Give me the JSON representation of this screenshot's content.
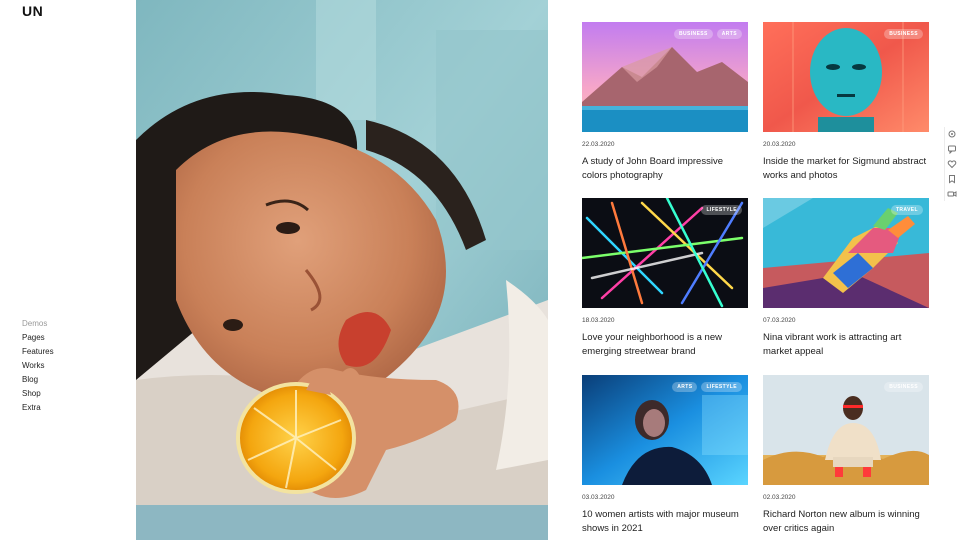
{
  "brand": {
    "logo_text": "UN"
  },
  "nav": {
    "items": [
      {
        "label": "Demos",
        "active": true
      },
      {
        "label": "Pages"
      },
      {
        "label": "Features"
      },
      {
        "label": "Works"
      },
      {
        "label": "Blog"
      },
      {
        "label": "Shop"
      },
      {
        "label": "Extra"
      }
    ]
  },
  "hero": {
    "image_subject": "woman-lying-with-orange-slice",
    "bg_color": "#8ec2c8"
  },
  "posts": [
    {
      "date": "22.03.2020",
      "title": "A study of John Board impressive colors photography",
      "tags": [
        "BUSINESS",
        "ARTS"
      ],
      "image": "pink-mountain-lake"
    },
    {
      "date": "20.03.2020",
      "title": "Inside the market for Sigmund abstract works and photos",
      "tags": [
        "BUSINESS"
      ],
      "image": "teal-face-abstract"
    },
    {
      "date": "18.03.2020",
      "title": "Love your neighborhood is a new emerging streetwear brand",
      "tags": [
        "LIFESTYLE"
      ],
      "image": "neon-lines"
    },
    {
      "date": "07.03.2020",
      "title": "Nina vibrant work is attracting art market appeal",
      "tags": [
        "TRAVEL"
      ],
      "image": "colorful-hand-painting"
    },
    {
      "date": "03.03.2020",
      "title": "10 women artists with major museum shows in 2021",
      "tags": [
        "ARTS",
        "LIFESTYLE"
      ],
      "image": "woman-blue-light"
    },
    {
      "date": "02.03.2020",
      "title": "Richard Norton new album is winning over critics again",
      "tags": [
        "BUSINESS"
      ],
      "image": "man-sitting-on-rocks"
    }
  ],
  "side_tools": [
    {
      "icon": "settings-icon"
    },
    {
      "icon": "comment-icon"
    },
    {
      "icon": "heart-icon"
    },
    {
      "icon": "bookmark-icon"
    },
    {
      "icon": "video-icon"
    }
  ]
}
